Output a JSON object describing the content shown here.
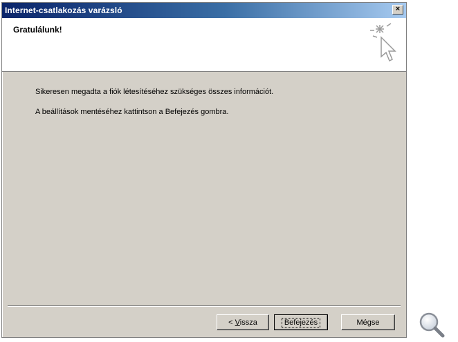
{
  "window": {
    "title": "Internet-csatlakozás varázsló",
    "close_glyph": "×"
  },
  "header": {
    "title": "Gratulálunk!",
    "icon": "wizard-cursor-sparkle-icon"
  },
  "body": {
    "line1": "Sikeresen megadta a fiók létesítéséhez szükséges összes információt.",
    "line2": "A beállítások mentéséhez kattintson a Befejezés gombra."
  },
  "buttons": {
    "back_prefix": "< ",
    "back_mnemonic": "V",
    "back_rest": "issza",
    "finish": "Befejezés",
    "cancel": "Mégse"
  },
  "overlay": {
    "icon": "magnifier-icon"
  }
}
